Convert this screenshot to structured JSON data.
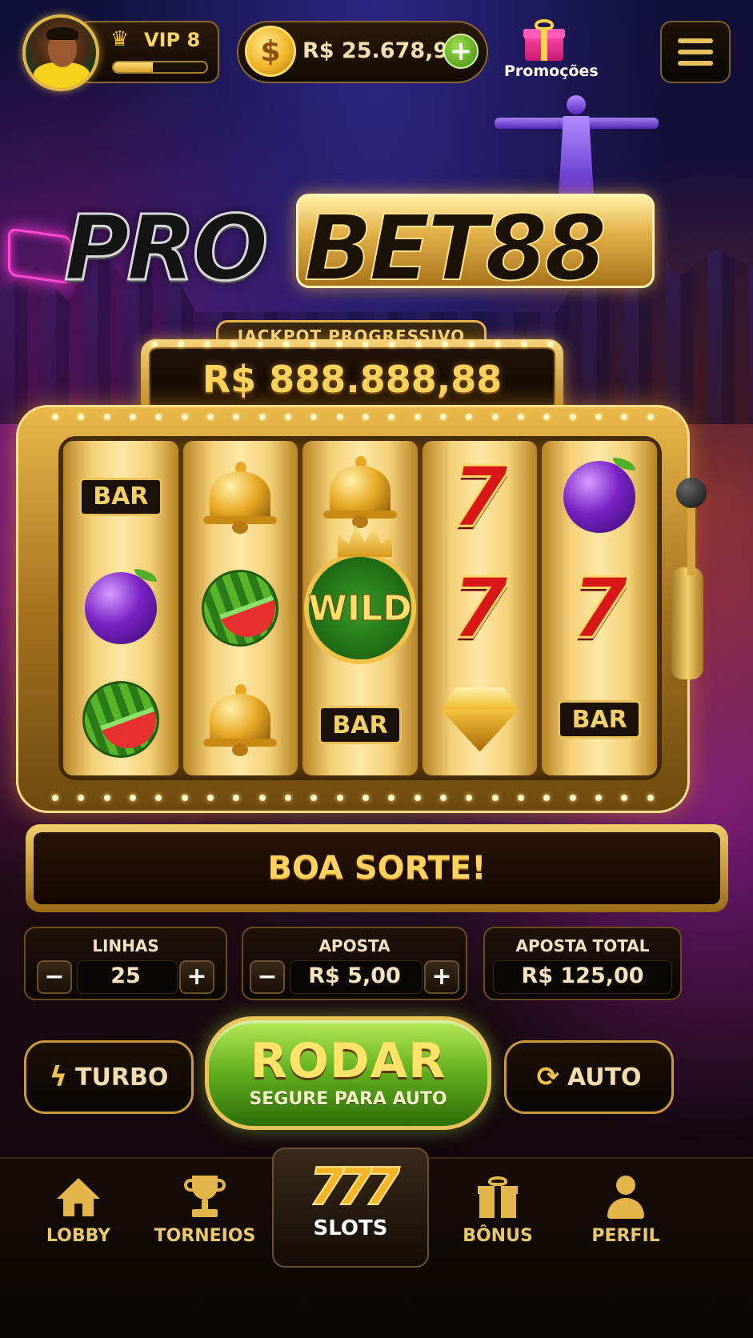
{
  "header": {
    "vip_label": "VIP 8",
    "vip_progress": 0.42,
    "balance": "R$ 25.678,90",
    "add_symbol": "+",
    "promo_label": "Promoções"
  },
  "logo": {
    "part1": "PRO",
    "part2": "BET88"
  },
  "jackpot": {
    "label": "JACKPOT PROGRESSIVO",
    "amount": "R$ 888.888,88"
  },
  "reels": [
    [
      "bar",
      "plum",
      "watermelon"
    ],
    [
      "bell",
      "watermelon",
      "bell"
    ],
    [
      "bell",
      "wild",
      "bar"
    ],
    [
      "seven",
      "seven",
      "diamond"
    ],
    [
      "plum",
      "seven",
      "bar"
    ]
  ],
  "symbols": {
    "bar_text": "BAR",
    "seven_text": "7",
    "wild_text": "WILD"
  },
  "message": "BOA SORTE!",
  "controls": {
    "lines": {
      "title": "LINHAS",
      "value": "25",
      "minus": "−",
      "plus": "+"
    },
    "bet": {
      "title": "APOSTA",
      "value": "R$ 5,00",
      "minus": "−",
      "plus": "+"
    },
    "total": {
      "title": "APOSTA TOTAL",
      "value": "R$ 125,00"
    }
  },
  "actions": {
    "turbo": "TURBO",
    "spin_title": "RODAR",
    "spin_sub": "SEGURE PARA AUTO",
    "auto": "AUTO"
  },
  "nav": [
    {
      "label": "LOBBY",
      "icon": "home-icon"
    },
    {
      "label": "TORNEIOS",
      "icon": "trophy-icon"
    },
    {
      "label": "SLOTS",
      "icon": "slots-777-icon",
      "active": true,
      "glyph": "777"
    },
    {
      "label": "BÔNUS",
      "icon": "gift-icon"
    },
    {
      "label": "PERFIL",
      "icon": "user-icon"
    }
  ],
  "colors": {
    "gold": "#e3b54a",
    "spin_green": "#5fae1c",
    "background": "#0b0613"
  }
}
